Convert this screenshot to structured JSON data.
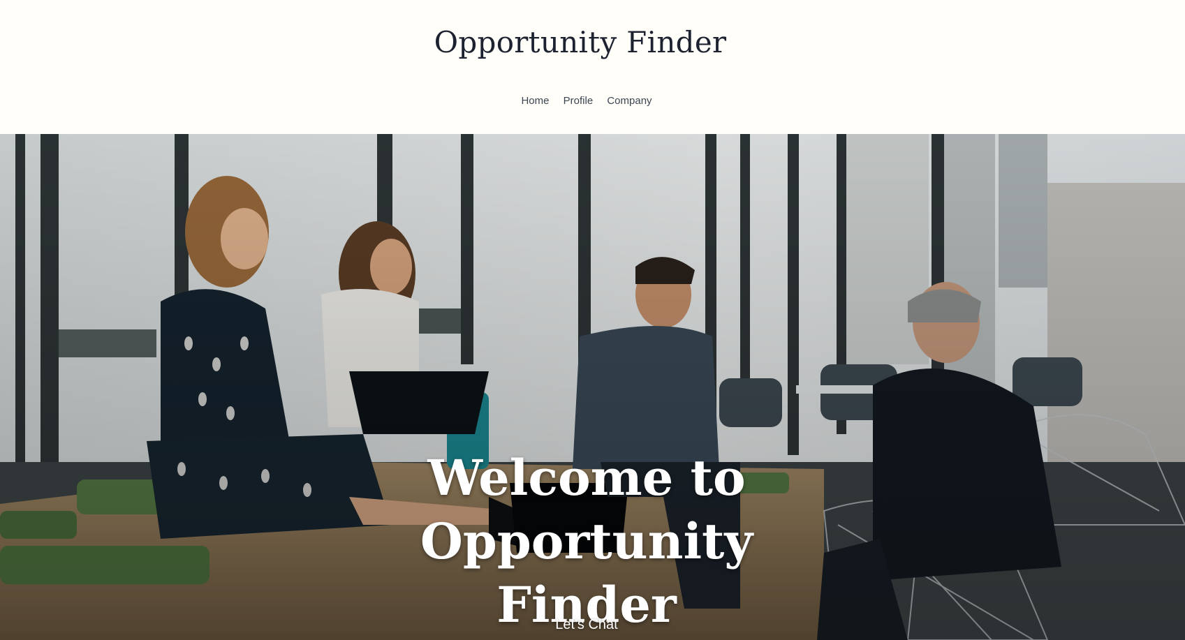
{
  "header": {
    "site_title": "Opportunity Finder",
    "nav": [
      {
        "label": "Home"
      },
      {
        "label": "Profile"
      },
      {
        "label": "Company"
      }
    ]
  },
  "hero": {
    "heading": "Welcome to Opportunity Finder",
    "cta_label": "Let's Chat",
    "background_image": "office-meeting-photo"
  },
  "colors": {
    "page_background": "#fffef8",
    "title_text": "#1c2230",
    "nav_text": "#3d4452",
    "hero_text": "#ffffff"
  }
}
